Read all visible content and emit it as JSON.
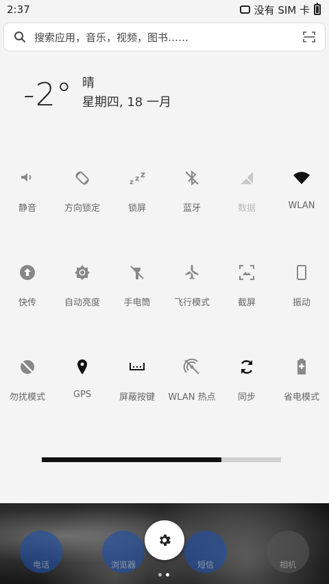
{
  "status": {
    "time": "2:37",
    "sim_text": "没有 SIM 卡"
  },
  "search": {
    "placeholder": "搜索应用，音乐，视频，图书……"
  },
  "weather": {
    "temperature": "-2°",
    "condition": "晴",
    "date": "星期四, 18 一月"
  },
  "tiles": [
    {
      "label": "静音",
      "icon": "volume-icon",
      "enabled": true
    },
    {
      "label": "方向锁定",
      "icon": "rotation-lock-icon",
      "enabled": true
    },
    {
      "label": "锁屏",
      "icon": "sleep-zzz-icon",
      "enabled": true
    },
    {
      "label": "蓝牙",
      "icon": "bluetooth-icon",
      "enabled": true
    },
    {
      "label": "数据",
      "icon": "mobile-data-icon",
      "enabled": false
    },
    {
      "label": "WLAN",
      "icon": "wifi-icon",
      "enabled": true
    },
    {
      "label": "快传",
      "icon": "upload-icon",
      "enabled": true
    },
    {
      "label": "自动亮度",
      "icon": "brightness-icon",
      "enabled": true
    },
    {
      "label": "手电筒",
      "icon": "flashlight-icon",
      "enabled": true
    },
    {
      "label": "飞行模式",
      "icon": "airplane-icon",
      "enabled": true
    },
    {
      "label": "截屏",
      "icon": "screenshot-icon",
      "enabled": true
    },
    {
      "label": "振动",
      "icon": "vibrate-icon",
      "enabled": true
    },
    {
      "label": "勿扰模式",
      "icon": "dnd-icon",
      "enabled": true
    },
    {
      "label": "GPS",
      "icon": "location-icon",
      "enabled": true
    },
    {
      "label": "屏蔽按键",
      "icon": "keyboard-block-icon",
      "enabled": true
    },
    {
      "label": "WLAN 热点",
      "icon": "hotspot-icon",
      "enabled": true
    },
    {
      "label": "同步",
      "icon": "sync-icon",
      "enabled": true
    },
    {
      "label": "省电模式",
      "icon": "battery-saver-icon",
      "enabled": true
    }
  ],
  "brightness": {
    "level": 0.75
  },
  "dock": {
    "apps": [
      {
        "label": "电话",
        "icon": "phone-icon",
        "color": "#1d4fa8"
      },
      {
        "label": "浏览器",
        "icon": "browser-icon",
        "color": "#1d4fa8"
      },
      {
        "label": "短信",
        "icon": "message-icon",
        "color": "#1d4fa8"
      },
      {
        "label": "相机",
        "icon": "camera-icon",
        "color": "#555555"
      }
    ],
    "fab_icon": "settings-gear-icon"
  },
  "colors": {
    "accent": "#111111",
    "tile_icon": "#888888",
    "tile_icon_disabled": "#c8c8c8"
  }
}
